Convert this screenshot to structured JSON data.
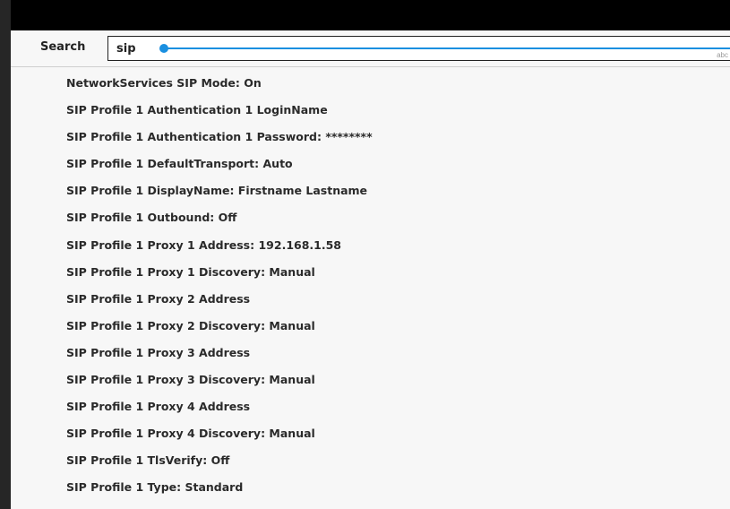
{
  "search": {
    "label": "Search",
    "value": "sip",
    "keyboard_hint": "abc",
    "accent_color": "#1a8fe0"
  },
  "results": [
    "NetworkServices SIP Mode: On",
    "SIP Profile 1 Authentication 1 LoginName",
    "SIP Profile 1 Authentication 1 Password: ********",
    "SIP Profile 1 DefaultTransport: Auto",
    "SIP Profile 1 DisplayName: Firstname Lastname",
    "SIP Profile 1 Outbound: Off",
    "SIP Profile 1 Proxy 1 Address: 192.168.1.58",
    "SIP Profile 1 Proxy 1 Discovery: Manual",
    "SIP Profile 1 Proxy 2 Address",
    "SIP Profile 1 Proxy 2 Discovery: Manual",
    "SIP Profile 1 Proxy 3 Address",
    "SIP Profile 1 Proxy 3 Discovery: Manual",
    "SIP Profile 1 Proxy 4 Address",
    "SIP Profile 1 Proxy 4 Discovery: Manual",
    "SIP Profile 1 TlsVerify: Off",
    "SIP Profile 1 Type: Standard"
  ]
}
